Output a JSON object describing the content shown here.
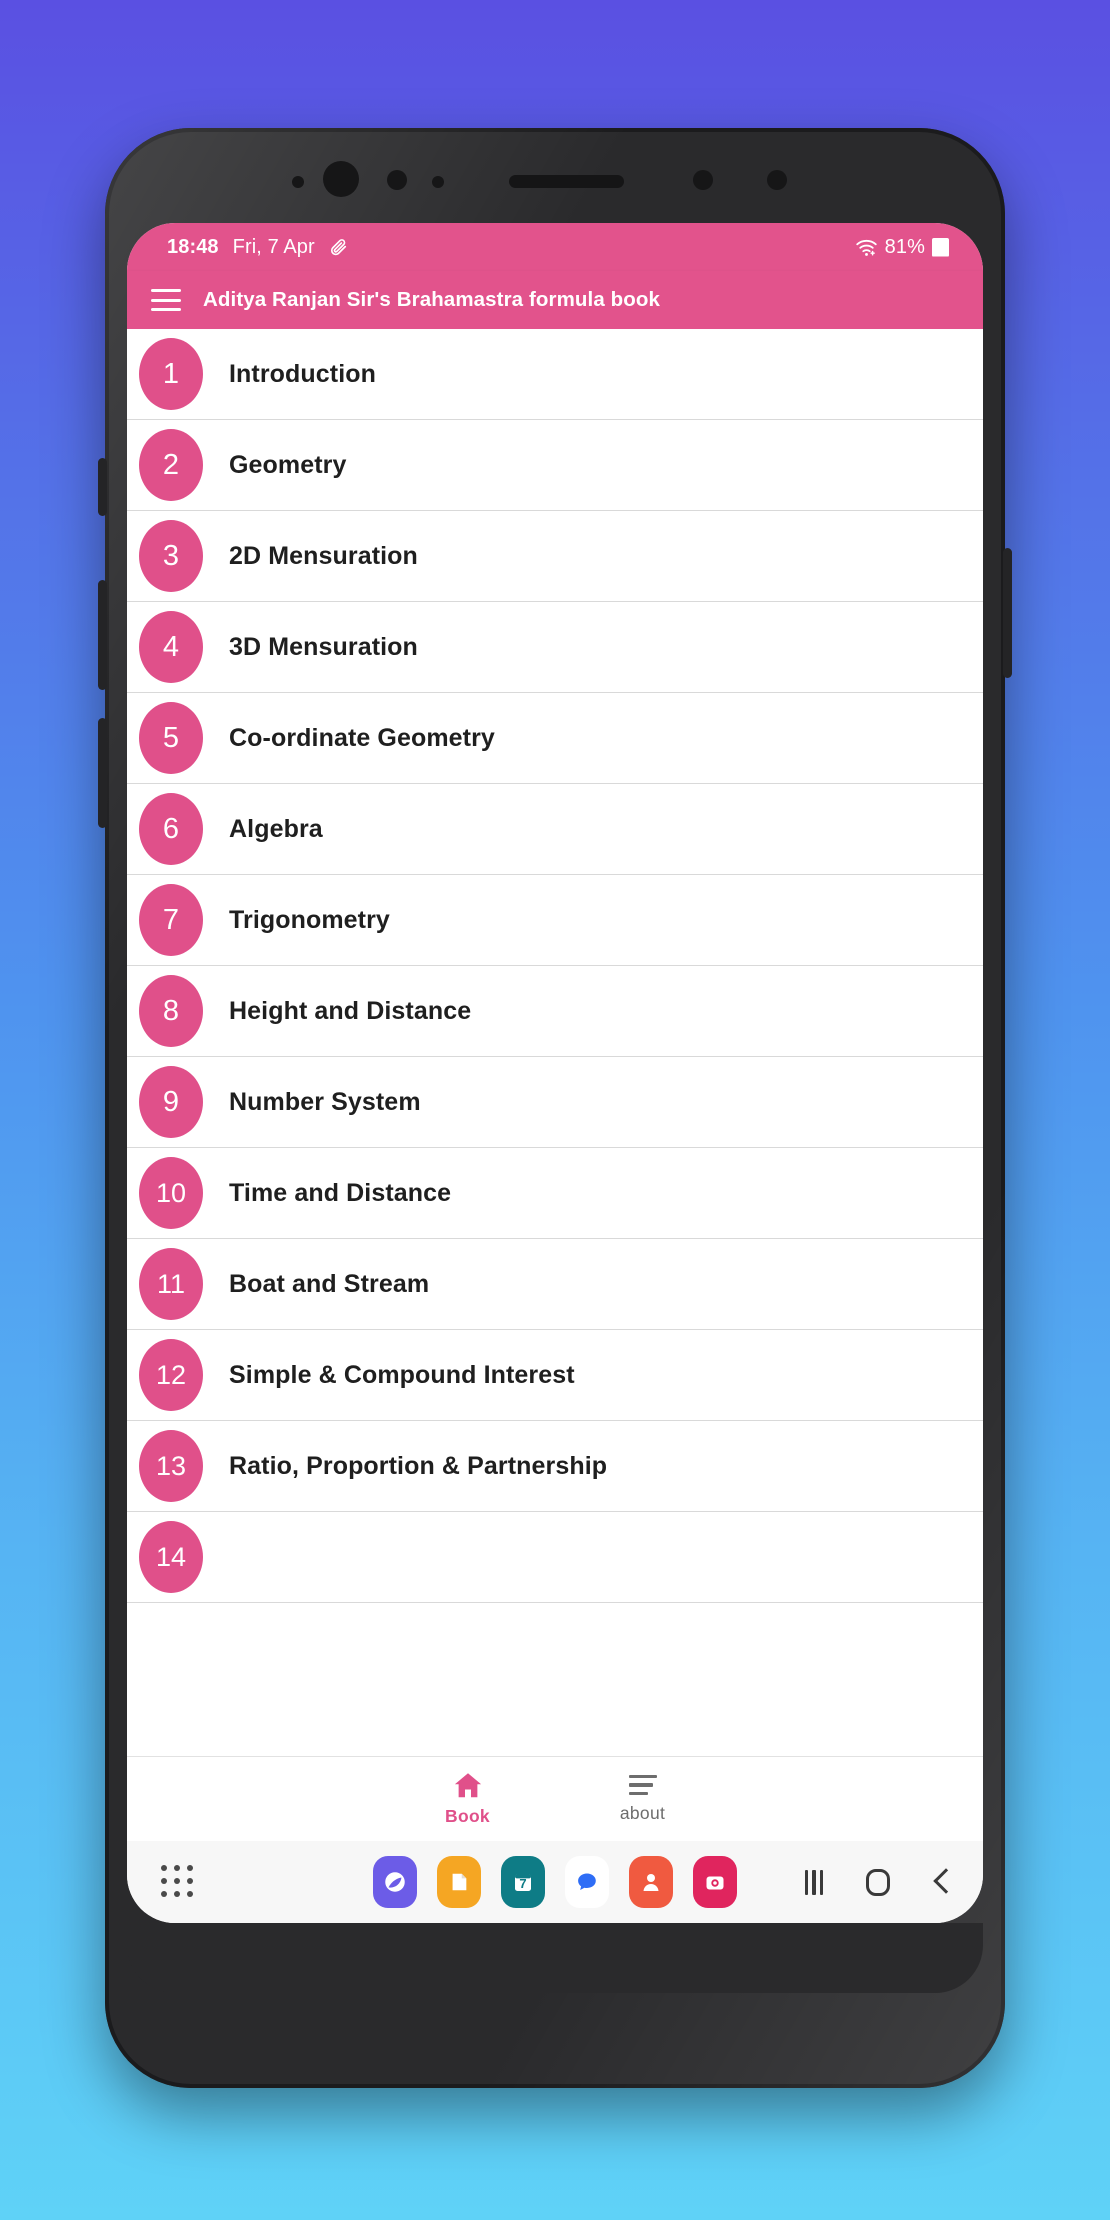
{
  "background": {
    "gradient_from": "#5a50e2",
    "gradient_to": "#5fd2f7"
  },
  "theme": {
    "accent_pink": "#e2538c",
    "badge_pink": "#e0508a",
    "inactive_gray": "#6d6d6d"
  },
  "status_bar": {
    "time": "18:48",
    "date": "Fri, 7 Apr",
    "notification_icon": "paperclip-icon",
    "wifi_icon": "wifi-icon",
    "battery_percent": "81%",
    "battery_icon": "battery-icon"
  },
  "app_bar": {
    "menu_icon": "hamburger-menu-icon",
    "title": "Aditya Ranjan Sir's Brahamastra formula book"
  },
  "chapter_list": [
    {
      "number": "1",
      "title": "Introduction"
    },
    {
      "number": "2",
      "title": "Geometry"
    },
    {
      "number": "3",
      "title": "2D Mensuration"
    },
    {
      "number": "4",
      "title": "3D Mensuration"
    },
    {
      "number": "5",
      "title": "Co-ordinate Geometry"
    },
    {
      "number": "6",
      "title": "Algebra"
    },
    {
      "number": "7",
      "title": "Trigonometry"
    },
    {
      "number": "8",
      "title": "Height and Distance"
    },
    {
      "number": "9",
      "title": "Number System"
    },
    {
      "number": "10",
      "title": "Time and Distance"
    },
    {
      "number": "11",
      "title": "Boat and Stream"
    },
    {
      "number": "12",
      "title": "Simple & Compound Interest"
    },
    {
      "number": "13",
      "title": "Ratio, Proportion & Partnership"
    },
    {
      "number": "14",
      "title": ""
    }
  ],
  "bottom_nav": {
    "items": [
      {
        "label": "Book",
        "icon": "home-icon",
        "active": true
      },
      {
        "label": "about",
        "icon": "list-lines-icon",
        "active": false
      }
    ]
  },
  "system_dock": {
    "apps_grid_icon": "app-grid-icon",
    "apps": [
      {
        "name": "samsung-internet-icon",
        "color": "#6c5ce7"
      },
      {
        "name": "notes-icon",
        "color": "#f5a623"
      },
      {
        "name": "calendar-icon",
        "color": "#0e7c86",
        "badge": "7"
      },
      {
        "name": "messages-icon",
        "color": "#ffffff"
      },
      {
        "name": "contacts-icon",
        "color": "#f05a40"
      },
      {
        "name": "camera-icon",
        "color": "#e0255e"
      }
    ],
    "nav_buttons": [
      {
        "name": "recents-button"
      },
      {
        "name": "home-button"
      },
      {
        "name": "back-button"
      }
    ]
  }
}
